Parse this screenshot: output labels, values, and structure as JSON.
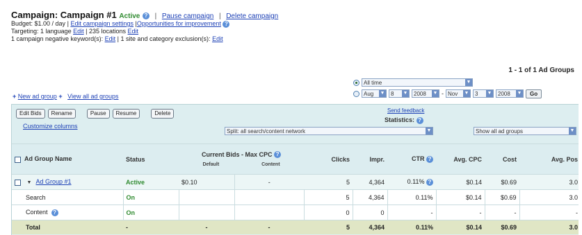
{
  "campaign": {
    "title": "Campaign: Campaign #1",
    "status": "Active",
    "pause_link": "Pause campaign",
    "delete_link": "Delete campaign",
    "budget_text": "Budget: $1.00 / day",
    "edit_settings_link": "Edit campaign settings",
    "opportunities_link": "Opportunities for improvement",
    "targeting_text": "Targeting: 1 language",
    "edit_link_1": "Edit",
    "locations_text": "235 locations",
    "edit_link_2": "Edit",
    "negatives_text": "1 campaign negative keyword(s):",
    "edit_link_3": "Edit",
    "exclusions_text": "1 site and category exclusion(s):",
    "edit_link_4": "Edit"
  },
  "range_text": "1 - 1 of 1 Ad Groups",
  "date_range": {
    "preset": "All time",
    "from_month": "Aug",
    "from_day": "8",
    "from_year": "2008",
    "to_month": "Nov",
    "to_day": "3",
    "to_year": "2008",
    "dash": "-",
    "go_label": "Go"
  },
  "links": {
    "new_ad_group": "New ad group",
    "view_all": "View all ad groups"
  },
  "toolbar": {
    "edit_bids": "Edit Bids",
    "rename": "Rename",
    "pause": "Pause",
    "resume": "Resume",
    "delete": "Delete",
    "customize": "Customize columns",
    "feedback": "Send feedback",
    "statistics": "Statistics:",
    "split_value": "Split: all search/content network",
    "show_value": "Show all ad groups"
  },
  "table": {
    "headers": {
      "name": "Ad Group Name",
      "status": "Status",
      "bids": "Current Bids - Max CPC",
      "bids_default": "Default",
      "bids_content": "Content",
      "clicks": "Clicks",
      "impr": "Impr.",
      "ctr": "CTR",
      "cpc": "Avg. CPC",
      "cost": "Cost",
      "pos": "Avg. Pos"
    },
    "rows": [
      {
        "name": "Ad Group #1",
        "status": "Active",
        "default_bid": "$0.10",
        "content_bid": "-",
        "clicks": "5",
        "impr": "4,364",
        "ctr": "0.11%",
        "cpc": "$0.14",
        "cost": "$0.69",
        "pos": "3.0"
      },
      {
        "name": "Search",
        "status": "On",
        "default_bid": "",
        "content_bid": "",
        "clicks": "5",
        "impr": "4,364",
        "ctr": "0.11%",
        "cpc": "$0.14",
        "cost": "$0.69",
        "pos": "3.0"
      },
      {
        "name": "Content",
        "status": "On",
        "default_bid": "",
        "content_bid": "",
        "clicks": "0",
        "impr": "0",
        "ctr": "-",
        "cpc": "-",
        "cost": "-",
        "pos": "-"
      },
      {
        "name": "Total",
        "status": "-",
        "default_bid": "-",
        "content_bid": "-",
        "clicks": "5",
        "impr": "4,364",
        "ctr": "0.11%",
        "cpc": "$0.14",
        "cost": "$0.69",
        "pos": "3.0"
      }
    ]
  },
  "colors": {
    "link": "#1b3fb5",
    "active": "#2f8a2f",
    "panel": "#ddeef0",
    "total_row": "#e0e6c5"
  }
}
